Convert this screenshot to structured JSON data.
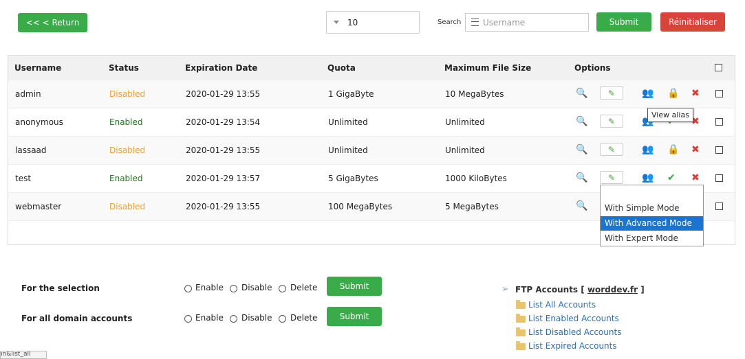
{
  "toolbar": {
    "return_label": "<< < Return",
    "per_page": "10",
    "search_label": "Search",
    "search_placeholder": "Username",
    "submit_label": "Submit",
    "reset_label": "Réinitialiser"
  },
  "table": {
    "headers": [
      "Username",
      "Status",
      "Expiration Date",
      "Quota",
      "Maximum File Size",
      "Options"
    ],
    "rows": [
      {
        "username": "admin",
        "status": "Disabled",
        "expiration": "2020-01-29 13:55",
        "quota": "1 GigaByte",
        "max_file_size": "10 MegaBytes"
      },
      {
        "username": "anonymous",
        "status": "Enabled",
        "expiration": "2020-01-29 13:54",
        "quota": "Unlimited",
        "max_file_size": "Unlimited"
      },
      {
        "username": "lassaad",
        "status": "Disabled",
        "expiration": "2020-01-29 13:55",
        "quota": "Unlimited",
        "max_file_size": "Unlimited"
      },
      {
        "username": "test",
        "status": "Enabled",
        "expiration": "2020-01-29 13:57",
        "quota": "5 GigaBytes",
        "max_file_size": "1000 KiloBytes"
      },
      {
        "username": "webmaster",
        "status": "Disabled",
        "expiration": "2020-01-29 13:55",
        "quota": "100 MegaBytes",
        "max_file_size": "5 MegaBytes"
      }
    ]
  },
  "tooltip": "View alias",
  "edit_menu": {
    "items": [
      "With Simple Mode",
      "With Advanced Mode",
      "With Expert Mode"
    ],
    "selected": "With Advanced Mode"
  },
  "bulk": {
    "selection_label": "For the selection",
    "domain_label": "For all domain accounts",
    "enable": "Enable",
    "disable": "Disable",
    "delete": "Delete",
    "submit": "Submit"
  },
  "ftp": {
    "title_prefix": "FTP Accounts [",
    "domain": "worddev.fr",
    "title_suffix": "]",
    "links": [
      "List All Accounts",
      "List Enabled Accounts",
      "List Disabled Accounts",
      "List Expired Accounts"
    ]
  },
  "status_bar": "in&list_all"
}
